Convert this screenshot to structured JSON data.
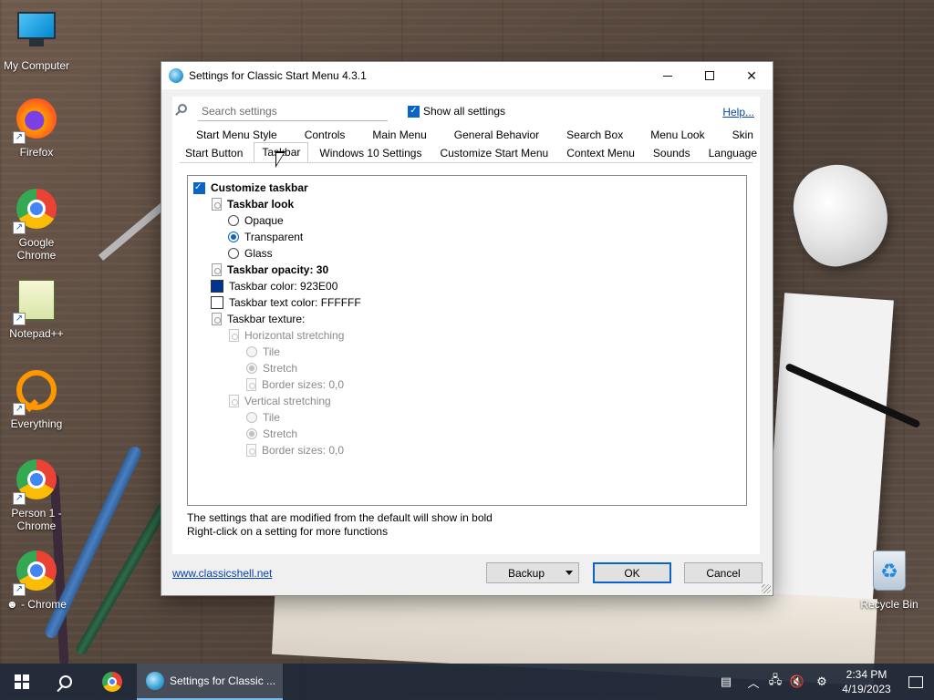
{
  "desktop": {
    "icons": [
      {
        "label": "My Computer"
      },
      {
        "label": "Firefox"
      },
      {
        "label": "Google Chrome"
      },
      {
        "label": "Notepad++"
      },
      {
        "label": "Everything"
      },
      {
        "label": "Person 1 - Chrome"
      },
      {
        "label": "☻ - Chrome"
      },
      {
        "label": "Recycle Bin"
      }
    ]
  },
  "dialog": {
    "title": "Settings for Classic Start Menu 4.3.1",
    "search_placeholder": "Search settings",
    "show_all_label": "Show all settings",
    "show_all_checked": true,
    "help_label": "Help...",
    "tabs_row1": [
      "Start Menu Style",
      "Controls",
      "Main Menu",
      "General Behavior",
      "Search Box",
      "Menu Look",
      "Skin"
    ],
    "tabs_row2": [
      "Start Button",
      "Taskbar",
      "Windows 10 Settings",
      "Customize Start Menu",
      "Context Menu",
      "Sounds",
      "Language"
    ],
    "selected_tab": "Taskbar",
    "settings": {
      "customize_taskbar": "Customize taskbar",
      "taskbar_look": "Taskbar look",
      "opaque": "Opaque",
      "transparent": "Transparent",
      "glass": "Glass",
      "taskbar_opacity": "Taskbar opacity: 30",
      "taskbar_color": "Taskbar color: 923E00",
      "taskbar_text_color": "Taskbar text color: FFFFFF",
      "taskbar_texture": "Taskbar texture:",
      "horizontal_stretching": "Horizontal stretching",
      "tile": "Tile",
      "stretch": "Stretch",
      "border_sizes": "Border sizes: 0,0",
      "vertical_stretching": "Vertical stretching"
    },
    "colors": {
      "taskbar_swatch": "#00358f",
      "text_swatch": "#ffffff"
    },
    "hint_line1": "The settings that are modified from the default will show in bold",
    "hint_line2": "Right-click on a setting for more functions",
    "website_link": "www.classicshell.net",
    "backup_label": "Backup",
    "ok_label": "OK",
    "cancel_label": "Cancel"
  },
  "taskbar": {
    "task_label": "Settings for Classic ...",
    "time": "2:34 PM",
    "date": "4/19/2023"
  }
}
